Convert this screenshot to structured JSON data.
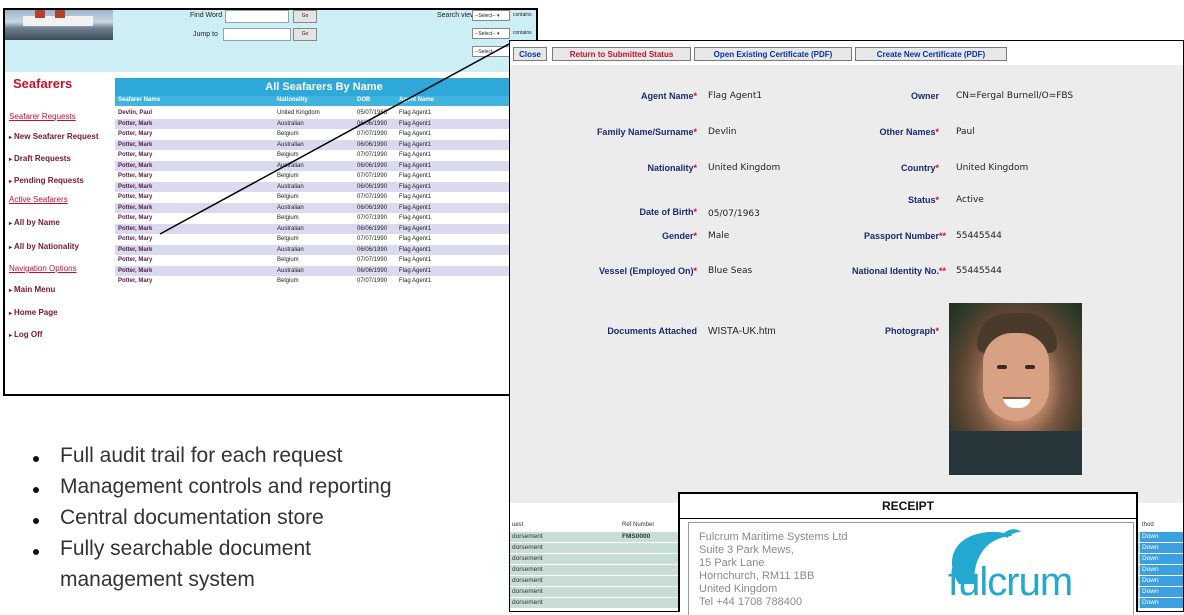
{
  "search": {
    "find_word_label": "Find Word",
    "jump_to_label": "Jump to",
    "go_label": "Go",
    "search_view_label": "Search view",
    "select_label": "--Select--",
    "contains_label": "contains"
  },
  "sidebar": {
    "brand": "Seafarers",
    "sections": [
      {
        "title": "Seafarer Requests",
        "items": [
          "New Seafarer Request",
          "Draft Requests",
          "Pending Requests"
        ]
      },
      {
        "title": "Active Seafarers",
        "items": [
          "All by Name",
          "All by Nationality"
        ]
      },
      {
        "title": "Navigation Options",
        "items": [
          "Main Menu",
          "Home Page",
          "Log Off"
        ]
      }
    ]
  },
  "seafarer_list": {
    "title": "All Seafarers By Name",
    "columns": [
      "Seafarer Name",
      "Nationality",
      "DOB",
      "Agent Name"
    ],
    "rows": [
      [
        "Devlin, Paul",
        "United Kingdom",
        "05/07/1963",
        "Flag Agent1"
      ],
      [
        "Potter, Mark",
        "Australian",
        "06/06/1990",
        "Flag Agent1"
      ],
      [
        "Potter, Mary",
        "Belgium",
        "07/07/1990",
        "Flag Agent1"
      ],
      [
        "Potter, Mark",
        "Australian",
        "06/06/1990",
        "Flag Agent1"
      ],
      [
        "Potter, Mary",
        "Belgium",
        "07/07/1990",
        "Flag Agent1"
      ],
      [
        "Potter, Mark",
        "Australian",
        "06/06/1990",
        "Flag Agent1"
      ],
      [
        "Potter, Mary",
        "Belgium",
        "07/07/1990",
        "Flag Agent1"
      ],
      [
        "Potter, Mark",
        "Australian",
        "06/06/1990",
        "Flag Agent1"
      ],
      [
        "Potter, Mary",
        "Belgium",
        "07/07/1990",
        "Flag Agent1"
      ],
      [
        "Potter, Mark",
        "Australian",
        "06/06/1990",
        "Flag Agent1"
      ],
      [
        "Potter, Mary",
        "Belgium",
        "07/07/1990",
        "Flag Agent1"
      ],
      [
        "Potter, Mark",
        "Australian",
        "06/06/1990",
        "Flag Agent1"
      ],
      [
        "Potter, Mary",
        "Belgium",
        "07/07/1990",
        "Flag Agent1"
      ],
      [
        "Potter, Mark",
        "Australian",
        "06/06/1990",
        "Flag Agent1"
      ],
      [
        "Potter, Mary",
        "Belgium",
        "07/07/1990",
        "Flag Agent1"
      ],
      [
        "Potter, Mark",
        "Australian",
        "06/06/1990",
        "Flag Agent1"
      ],
      [
        "Potter, Mary",
        "Belgium",
        "07/07/1990",
        "Flag Agent1"
      ]
    ]
  },
  "toolbar": {
    "close": "Close",
    "return": "Return to Submitted Status",
    "open_cert": "Open Existing Certificate (PDF)",
    "create_cert": "Create New Certificate (PDF)"
  },
  "certificate_form": {
    "agent_name": {
      "label": "Agent Name",
      "value": "Flag Agent1"
    },
    "owner": {
      "label": "Owner",
      "value": "CN=Fergal Burnell/O=FBS"
    },
    "family_name": {
      "label": "Family Name/Surname",
      "value": "Devlin"
    },
    "other_names": {
      "label": "Other Names",
      "value": "Paul"
    },
    "nationality": {
      "label": "Nationality",
      "value": "United Kingdom"
    },
    "country": {
      "label": "Country",
      "value": "United Kingdom"
    },
    "status": {
      "label": "Status",
      "value": "Active"
    },
    "dob": {
      "label": "Date of Birth",
      "value": "05/07/1963"
    },
    "gender": {
      "label": "Gender",
      "value": "Male"
    },
    "passport": {
      "label": "Passport Number",
      "value": "55445544"
    },
    "vessel": {
      "label": "Vessel (Employed On)",
      "value": "Blue Seas"
    },
    "national_id": {
      "label": "National Identity No.",
      "value": "55445544"
    },
    "documents": {
      "label": "Documents Attached",
      "value": "WISTA-UK.htm"
    },
    "photograph": {
      "label": "Photograph"
    },
    "req_mark": "*",
    "req_mark_double": "**"
  },
  "bottom_table": {
    "col_request": "uest",
    "col_ref": "Ref Number",
    "col_method": "thod",
    "row_label": "dorsement",
    "ref_value": "FMS0000",
    "method_value": "Down"
  },
  "receipt": {
    "title": "RECEIPT",
    "address": [
      "Fulcrum Maritime Systems Ltd",
      "Suite 3 Park Mews,",
      "15 Park Lane",
      "Hornchurch, RM11 1BB",
      "United Kingdom",
      "Tel +44 1708 788400"
    ],
    "logo_text": "fulcrum"
  },
  "bullets": [
    "Full audit trail for each request",
    "Management controls and reporting",
    "Central documentation store",
    "Fully searchable document",
    "management system"
  ],
  "colors": {
    "header_blue": "#2ea8d8",
    "brand_red": "#c8102e",
    "label_navy": "#1c2b6e",
    "logo_teal": "#23a8cf"
  }
}
